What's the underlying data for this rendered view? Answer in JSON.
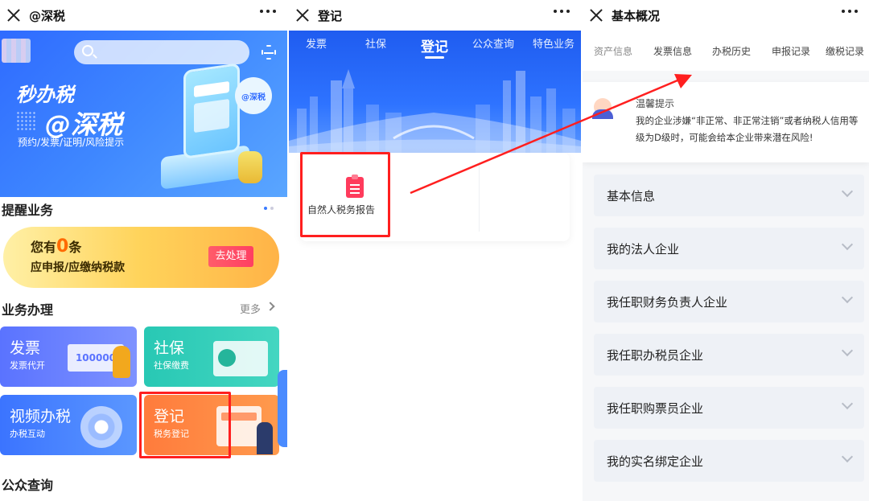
{
  "panel1": {
    "title": "@深税",
    "banner": {
      "line1": "秒办税",
      "line2": "@深税",
      "line3": "预约/发票/证明/风险提示",
      "bubble": "@深税"
    },
    "reminder": {
      "section_title": "提醒业务",
      "prefix": "您有",
      "count": "0",
      "suffix": "条",
      "line2": "应申报/应缴纳税款",
      "button": "去处理"
    },
    "business": {
      "section_title": "业务办理",
      "more": "更多",
      "tiles": [
        {
          "title": "发票",
          "sub": "发票代开",
          "deco": "100000"
        },
        {
          "title": "社保",
          "sub": "社保缴费"
        },
        {
          "title": "视频办税",
          "sub": "办税互动"
        },
        {
          "title": "登记",
          "sub": "税务登记"
        }
      ]
    },
    "public_query": "公众查询"
  },
  "panel2": {
    "title": "登记",
    "tabs": [
      "发票",
      "社保",
      "登记",
      "公众查询",
      "特色业务"
    ],
    "active_tab": "登记",
    "item": "自然人税务报告"
  },
  "panel3": {
    "title": "基本概况",
    "tabs": [
      "资产信息",
      "发票信息",
      "办税历史",
      "申报记录",
      "缴税记录"
    ],
    "tip": {
      "title": "温馨提示",
      "body": "我的企业涉嫌“非正常、非正常注销”或者纳税人信用等级为D级时，可能会给本企业带来潜在风险!"
    },
    "rows": [
      "基本信息",
      "我的法人企业",
      "我任职财务负责人企业",
      "我任职办税员企业",
      "我任职购票员企业",
      "我的实名绑定企业"
    ]
  },
  "colors": {
    "primary_blue": "#2f6bff",
    "highlight_red": "#ff1f1f",
    "orange": "#ff7b3c"
  }
}
